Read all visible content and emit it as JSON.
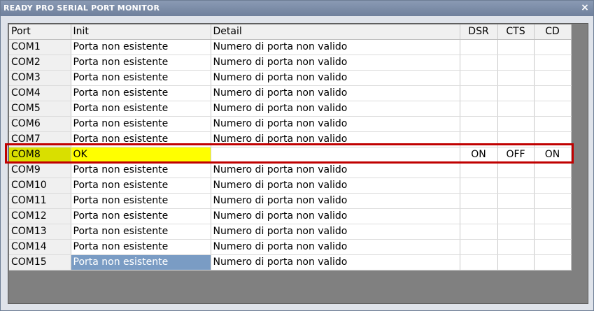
{
  "window": {
    "title": "READY PRO SERIAL PORT MONITOR",
    "close_label": "×"
  },
  "columns": [
    "Port",
    "Init",
    "Detail",
    "DSR",
    "CTS",
    "CD"
  ],
  "rows": [
    {
      "port": "COM1",
      "init": "Porta non esistente",
      "detail": "Numero di porta non valido",
      "dsr": "",
      "cts": "",
      "cd": ""
    },
    {
      "port": "COM2",
      "init": "Porta non esistente",
      "detail": "Numero di porta non valido",
      "dsr": "",
      "cts": "",
      "cd": ""
    },
    {
      "port": "COM3",
      "init": "Porta non esistente",
      "detail": "Numero di porta non valido",
      "dsr": "",
      "cts": "",
      "cd": ""
    },
    {
      "port": "COM4",
      "init": "Porta non esistente",
      "detail": "Numero di porta non valido",
      "dsr": "",
      "cts": "",
      "cd": ""
    },
    {
      "port": "COM5",
      "init": "Porta non esistente",
      "detail": "Numero di porta non valido",
      "dsr": "",
      "cts": "",
      "cd": ""
    },
    {
      "port": "COM6",
      "init": "Porta non esistente",
      "detail": "Numero di porta non valido",
      "dsr": "",
      "cts": "",
      "cd": ""
    },
    {
      "port": "COM7",
      "init": "Porta non esistente",
      "detail": "Numero di porta non valido",
      "dsr": "",
      "cts": "",
      "cd": ""
    },
    {
      "port": "COM8",
      "init": "OK",
      "detail": "",
      "dsr": "ON",
      "cts": "OFF",
      "cd": "ON"
    },
    {
      "port": "COM9",
      "init": "Porta non esistente",
      "detail": "Numero di porta non valido",
      "dsr": "",
      "cts": "",
      "cd": ""
    },
    {
      "port": "COM10",
      "init": "Porta non esistente",
      "detail": "Numero di porta non valido",
      "dsr": "",
      "cts": "",
      "cd": ""
    },
    {
      "port": "COM11",
      "init": "Porta non esistente",
      "detail": "Numero di porta non valido",
      "dsr": "",
      "cts": "",
      "cd": ""
    },
    {
      "port": "COM12",
      "init": "Porta non esistente",
      "detail": "Numero di porta non valido",
      "dsr": "",
      "cts": "",
      "cd": ""
    },
    {
      "port": "COM13",
      "init": "Porta non esistente",
      "detail": "Numero di porta non valido",
      "dsr": "",
      "cts": "",
      "cd": ""
    },
    {
      "port": "COM14",
      "init": "Porta non esistente",
      "detail": "Numero di porta non valido",
      "dsr": "",
      "cts": "",
      "cd": ""
    },
    {
      "port": "COM15",
      "init": "Porta non esistente",
      "detail": "Numero di porta non valido",
      "dsr": "",
      "cts": "",
      "cd": ""
    }
  ],
  "highlighted_port": "COM8",
  "selected_cell": {
    "port": "COM15",
    "column": "init"
  },
  "colors": {
    "highlight_row_init": "#ffff00",
    "highlight_row_port": "#d9df00",
    "highlight_frame": "#c00000",
    "selection": "#7a9cc4",
    "title_bar": "#7a8aa6"
  }
}
